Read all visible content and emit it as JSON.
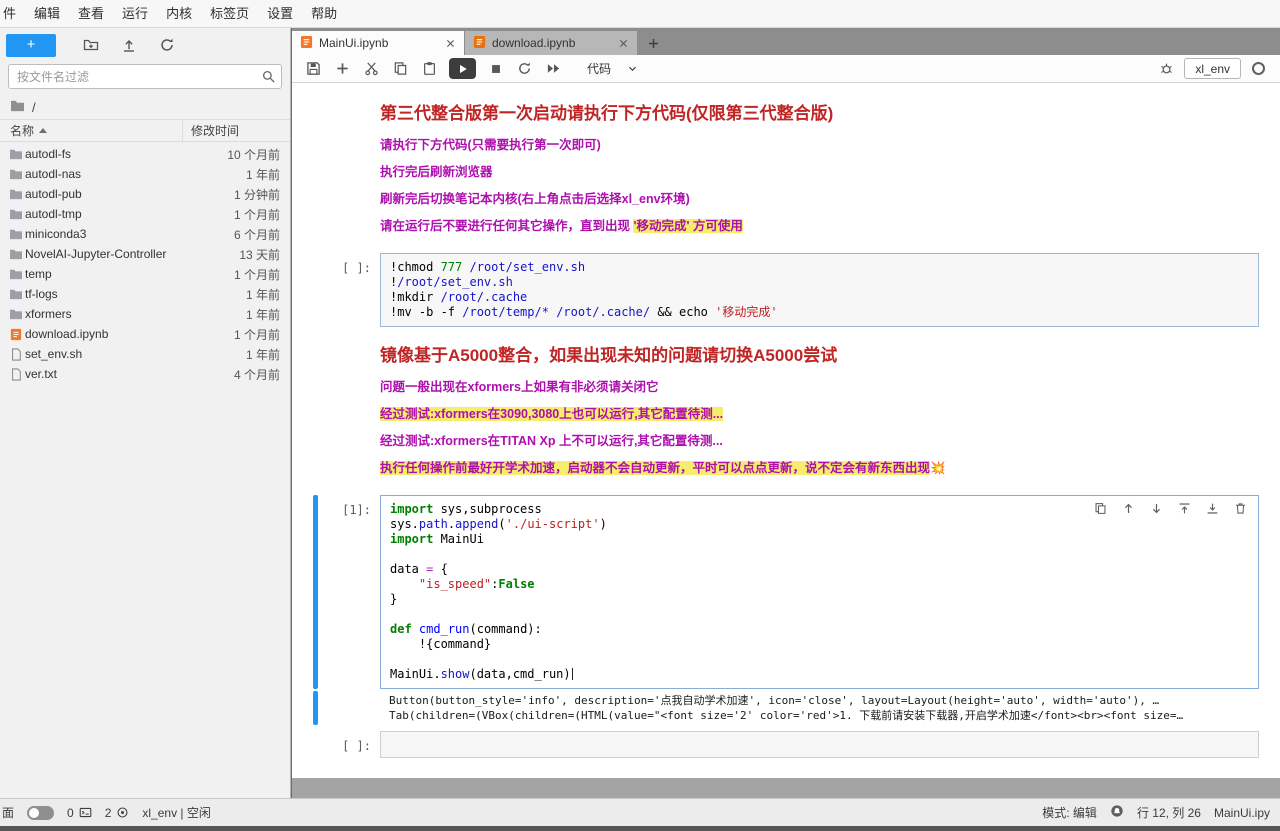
{
  "colors": {
    "accent_blue": "#2196f3",
    "heading_red": "#c02525",
    "note_magenta": "#ae10ae",
    "highlight_yellow": "#f6ec6d",
    "notebook_icon_orange": "#f37726",
    "keyword_green": "#008000",
    "string_red": "#ba2121"
  },
  "menubar": {
    "items": [
      "件",
      "编辑",
      "查看",
      "运行",
      "内核",
      "标签页",
      "设置",
      "帮助"
    ]
  },
  "sidebar": {
    "new_button_label": "+",
    "search_placeholder": "按文件名过滤",
    "breadcrumb_root": "/",
    "columns": {
      "name": "名称",
      "modified": "修改时间"
    },
    "files": [
      {
        "name": "autodl-fs",
        "time": "10 个月前",
        "type": "folder"
      },
      {
        "name": "autodl-nas",
        "time": "1 年前",
        "type": "folder"
      },
      {
        "name": "autodl-pub",
        "time": "1 分钟前",
        "type": "folder"
      },
      {
        "name": "autodl-tmp",
        "time": "1 个月前",
        "type": "folder"
      },
      {
        "name": "miniconda3",
        "time": "6 个月前",
        "type": "folder"
      },
      {
        "name": "NovelAI-Jupyter-Controller",
        "time": "13 天前",
        "type": "folder"
      },
      {
        "name": "temp",
        "time": "1 个月前",
        "type": "folder"
      },
      {
        "name": "tf-logs",
        "time": "1 年前",
        "type": "folder"
      },
      {
        "name": "xformers",
        "time": "1 年前",
        "type": "folder"
      },
      {
        "name": "download.ipynb",
        "time": "1 个月前",
        "type": "notebook"
      },
      {
        "name": "set_env.sh",
        "time": "1 年前",
        "type": "file"
      },
      {
        "name": "ver.txt",
        "time": "4 个月前",
        "type": "file"
      }
    ]
  },
  "tabs": [
    {
      "label": "MainUi.ipynb",
      "active": true
    },
    {
      "label": "download.ipynb",
      "active": false
    }
  ],
  "toolbar": {
    "cell_type": "代码",
    "kernel": "xl_env"
  },
  "notebook": {
    "md1": {
      "heading": "第三代整合版第一次启动请执行下方代码(仅限第三代整合版)",
      "lines": [
        [
          {
            "text": "请执行下方代码(只需要执行第一次即可)",
            "hl": false
          }
        ],
        [
          {
            "text": "执行完后刷新浏览器",
            "hl": false
          }
        ],
        [
          {
            "text": "刷新完后切换笔记本内核(右上角点击后选择xl_env环境)",
            "hl": false
          }
        ],
        [
          {
            "text": "请在运行后不要进行任何其它操作，直到出现 ",
            "hl": false
          },
          {
            "text": "'移动完成' 方可使用",
            "hl": true
          }
        ]
      ]
    },
    "code1": {
      "prompt": "[ ]:",
      "lines": [
        [
          [
            "t",
            "!chmod "
          ],
          [
            "n",
            "777"
          ],
          [
            "t",
            " "
          ],
          [
            "b",
            "/root/set_env.sh"
          ]
        ],
        [
          [
            "t",
            "!"
          ],
          [
            "b",
            "/root/set_env.sh"
          ]
        ],
        [
          [
            "t",
            "!mkdir "
          ],
          [
            "b",
            "/root/.cache"
          ]
        ],
        [
          [
            "t",
            "!mv -b -f "
          ],
          [
            "b",
            "/root/temp/*"
          ],
          [
            "t",
            " "
          ],
          [
            "b",
            "/root/.cache/"
          ],
          [
            "t",
            " && echo "
          ],
          [
            "s",
            "'移动完成'"
          ]
        ]
      ]
    },
    "md2": {
      "heading": "镜像基于A5000整合，如果出现未知的问题请切换A5000尝试",
      "lines": [
        [
          {
            "text": "问题一般出现在xformers上如果有非必须请关闭它",
            "hl": false
          }
        ],
        [
          {
            "text": "经过测试:xformers在3090,3080上也可以运行,其它配置待测...",
            "hl": true
          }
        ],
        [
          {
            "text": "经过测试:xformers在TITAN Xp 上不可以运行,其它配置待测...",
            "hl": false
          }
        ],
        [
          {
            "text": "执行任何操作前最好开学术加速，启动器不会自动更新，平时可以点点更新，说不定会有新东西出现",
            "hl": true
          },
          {
            "text": "💥",
            "hl": false
          }
        ]
      ]
    },
    "code2": {
      "prompt": "[1]:",
      "lines": [
        [
          [
            "k",
            "import"
          ],
          [
            "t",
            " sys,subprocess"
          ]
        ],
        [
          [
            "t",
            "sys."
          ],
          [
            "b",
            "path"
          ],
          [
            "t",
            "."
          ],
          [
            "b",
            "append"
          ],
          [
            "t",
            "("
          ],
          [
            "s",
            "'./ui-script'"
          ],
          [
            "t",
            ")"
          ]
        ],
        [
          [
            "k",
            "import"
          ],
          [
            "t",
            " MainUi"
          ]
        ],
        [
          [
            "t",
            ""
          ]
        ],
        [
          [
            "t",
            "data "
          ],
          [
            "o",
            "="
          ],
          [
            "t",
            " {"
          ]
        ],
        [
          [
            "t",
            "    "
          ],
          [
            "s",
            "\"is_speed\""
          ],
          [
            "t",
            ":"
          ],
          [
            "k",
            "False"
          ]
        ],
        [
          [
            "t",
            "}"
          ]
        ],
        [
          [
            "t",
            ""
          ]
        ],
        [
          [
            "k",
            "def"
          ],
          [
            "t",
            " "
          ],
          [
            "f",
            "cmd_run"
          ],
          [
            "t",
            "(command):"
          ]
        ],
        [
          [
            "t",
            "    !{command}"
          ]
        ],
        [
          [
            "t",
            ""
          ]
        ],
        [
          [
            "t",
            "MainUi."
          ],
          [
            "b",
            "show"
          ],
          [
            "t",
            "(data,cmd_run)"
          ],
          [
            "c",
            ""
          ]
        ]
      ]
    },
    "output_lines": [
      "Button(button_style='info', description='点我自动学术加速', icon='close', layout=Layout(height='auto', width='auto'), …",
      "Tab(children=(VBox(children=(HTML(value=\"<font size='2' color='red'>1. 下载前请安装下载器,开启学术加速</font><br><font size=…"
    ],
    "code3": {
      "prompt": "[ ]:"
    }
  },
  "statusbar": {
    "simple_label": "面",
    "terminals": "0",
    "kernels": "2",
    "kernel_status": "xl_env | 空闲",
    "mode": "模式: 编辑",
    "position": "行 12, 列 26",
    "filename": "MainUi.ipy"
  }
}
